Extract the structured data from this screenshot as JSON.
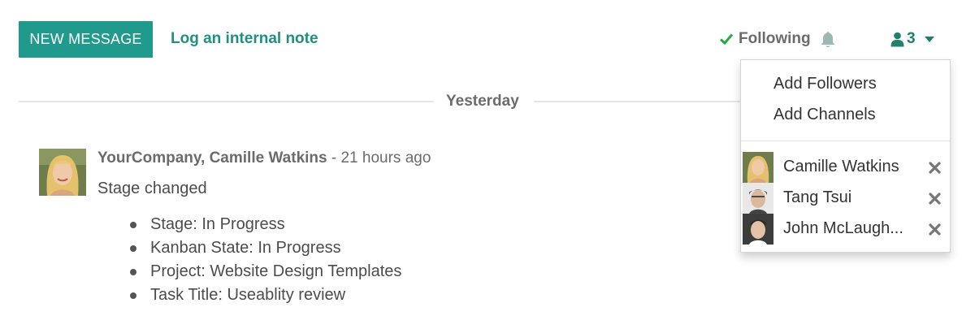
{
  "toolbar": {
    "new_message_label": "NEW MESSAGE",
    "log_note_label": "Log an internal note",
    "following_label": "Following",
    "followers_count": "3"
  },
  "thread": {
    "date_separator": "Yesterday",
    "messages": [
      {
        "author": "YourCompany, Camille Watkins",
        "time": "- 21 hours ago",
        "subject": "Stage changed",
        "tracking": [
          "Stage: In Progress",
          "Kanban State: In Progress",
          "Project: Website Design Templates",
          "Task Title: Useablity review"
        ]
      }
    ]
  },
  "followers_menu": {
    "actions": [
      "Add Followers",
      "Add Channels"
    ],
    "followers": [
      {
        "name": "Camille Watkins"
      },
      {
        "name": "Tang Tsui"
      },
      {
        "name": "John McLaugh..."
      }
    ]
  },
  "icons": {
    "check": "check-icon",
    "bell": "bell-icon",
    "user": "user-icon",
    "caret": "caret-down-icon",
    "remove": "remove-follower-icon"
  },
  "colors": {
    "primary": "#1f9a8c",
    "link": "#1f8f83",
    "check": "#28a745",
    "bell": "#9cb8b4"
  }
}
